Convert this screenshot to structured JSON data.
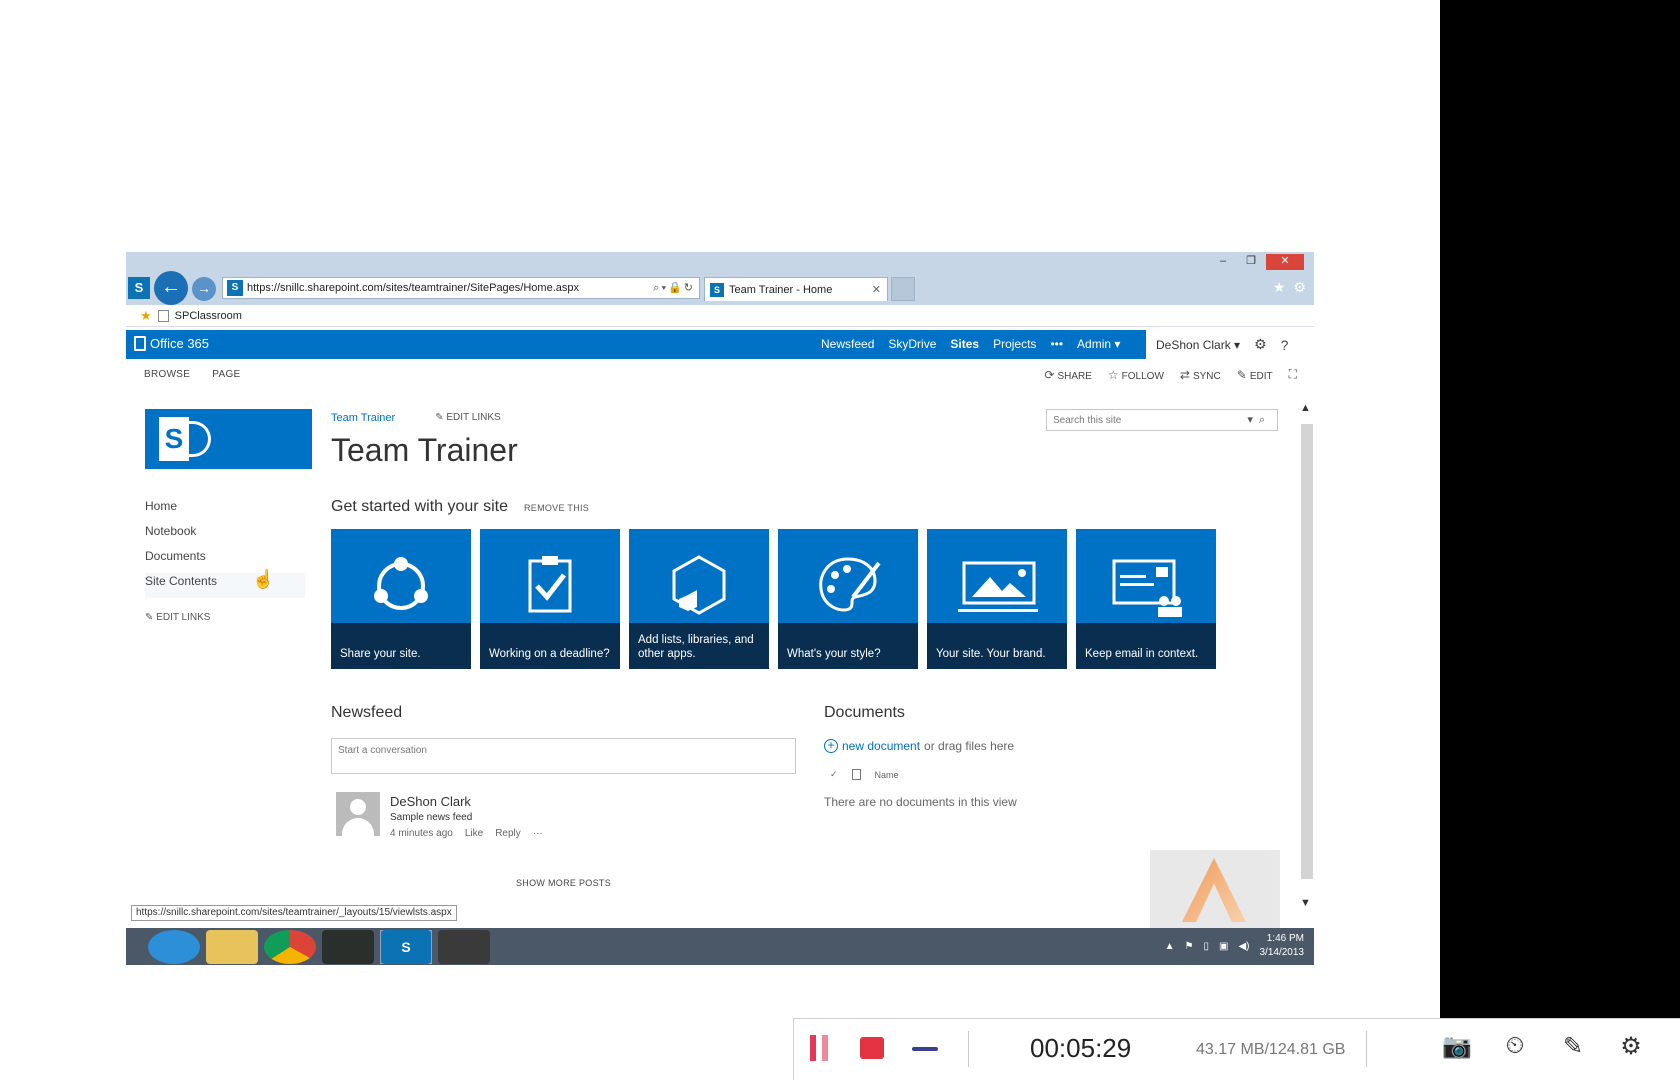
{
  "window": {
    "minimize": "–",
    "restore": "❐",
    "close": "✕"
  },
  "browser": {
    "url": "https://snillc.sharepoint.com/sites/teamtrainer/SitePages/Home.aspx",
    "tab_title": "Team Trainer - Home",
    "tab_close": "✕",
    "favorites_item": "SPClassroom",
    "status_url": "https://snillc.sharepoint.com/sites/teamtrainer/_layouts/15/viewlsts.aspx"
  },
  "o365": {
    "brand": "Office 365",
    "links": [
      "Newsfeed",
      "SkyDrive",
      "Sites",
      "Projects",
      "•••",
      "Admin ▾"
    ],
    "active_link": "Sites",
    "user": "DeShon Clark ▾",
    "settings": "⚙",
    "help": "?"
  },
  "ribbon": {
    "tabs": [
      "BROWSE",
      "PAGE"
    ],
    "actions": [
      {
        "icon": "share-icon",
        "glyph": "⟳",
        "label": "SHARE"
      },
      {
        "icon": "star-icon",
        "glyph": "☆",
        "label": "FOLLOW"
      },
      {
        "icon": "sync-icon",
        "glyph": "⇄",
        "label": "SYNC"
      },
      {
        "icon": "pencil-icon",
        "glyph": "✎",
        "label": "EDIT"
      }
    ],
    "focus": "⛶"
  },
  "site": {
    "breadcrumb": "Team Trainer",
    "edit_links": "EDIT LINKS",
    "title": "Team Trainer",
    "search_placeholder": "Search this site"
  },
  "quicklaunch": {
    "items": [
      "Home",
      "Notebook",
      "Documents",
      "Site Contents"
    ],
    "edit_links": "EDIT LINKS"
  },
  "get_started": {
    "heading": "Get started with your site",
    "remove": "REMOVE THIS",
    "tiles": [
      {
        "icon": "share-icon",
        "caption": "Share your site."
      },
      {
        "icon": "clipboard-check-icon",
        "caption": "Working on a deadline?"
      },
      {
        "icon": "hexagon-icon",
        "caption": "Add lists, libraries, and other apps."
      },
      {
        "icon": "palette-icon",
        "caption": "What's your style?"
      },
      {
        "icon": "image-icon",
        "caption": "Your site. Your brand."
      },
      {
        "icon": "email-card-icon",
        "caption": "Keep email in context."
      }
    ]
  },
  "newsfeed": {
    "heading": "Newsfeed",
    "placeholder": "Start a conversation",
    "post": {
      "author": "DeShon Clark",
      "text": "Sample news feed",
      "time": "4 minutes ago",
      "like": "Like",
      "reply": "Reply",
      "more": "···"
    },
    "show_more": "SHOW MORE POSTS"
  },
  "documents": {
    "heading": "Documents",
    "new_doc": "new document",
    "drag_text": "or drag files here",
    "col_name": "Name",
    "empty": "There are no documents in this view"
  },
  "taskbar": {
    "time": "1:46 PM",
    "date": "3/14/2013"
  },
  "recorder": {
    "elapsed": "00:05:29",
    "size": "43.17 MB/124.81 GB"
  },
  "colors": {
    "sp_blue": "#0072c6",
    "tile_caption": "#0a2e4f",
    "record_red": "#e53242"
  }
}
